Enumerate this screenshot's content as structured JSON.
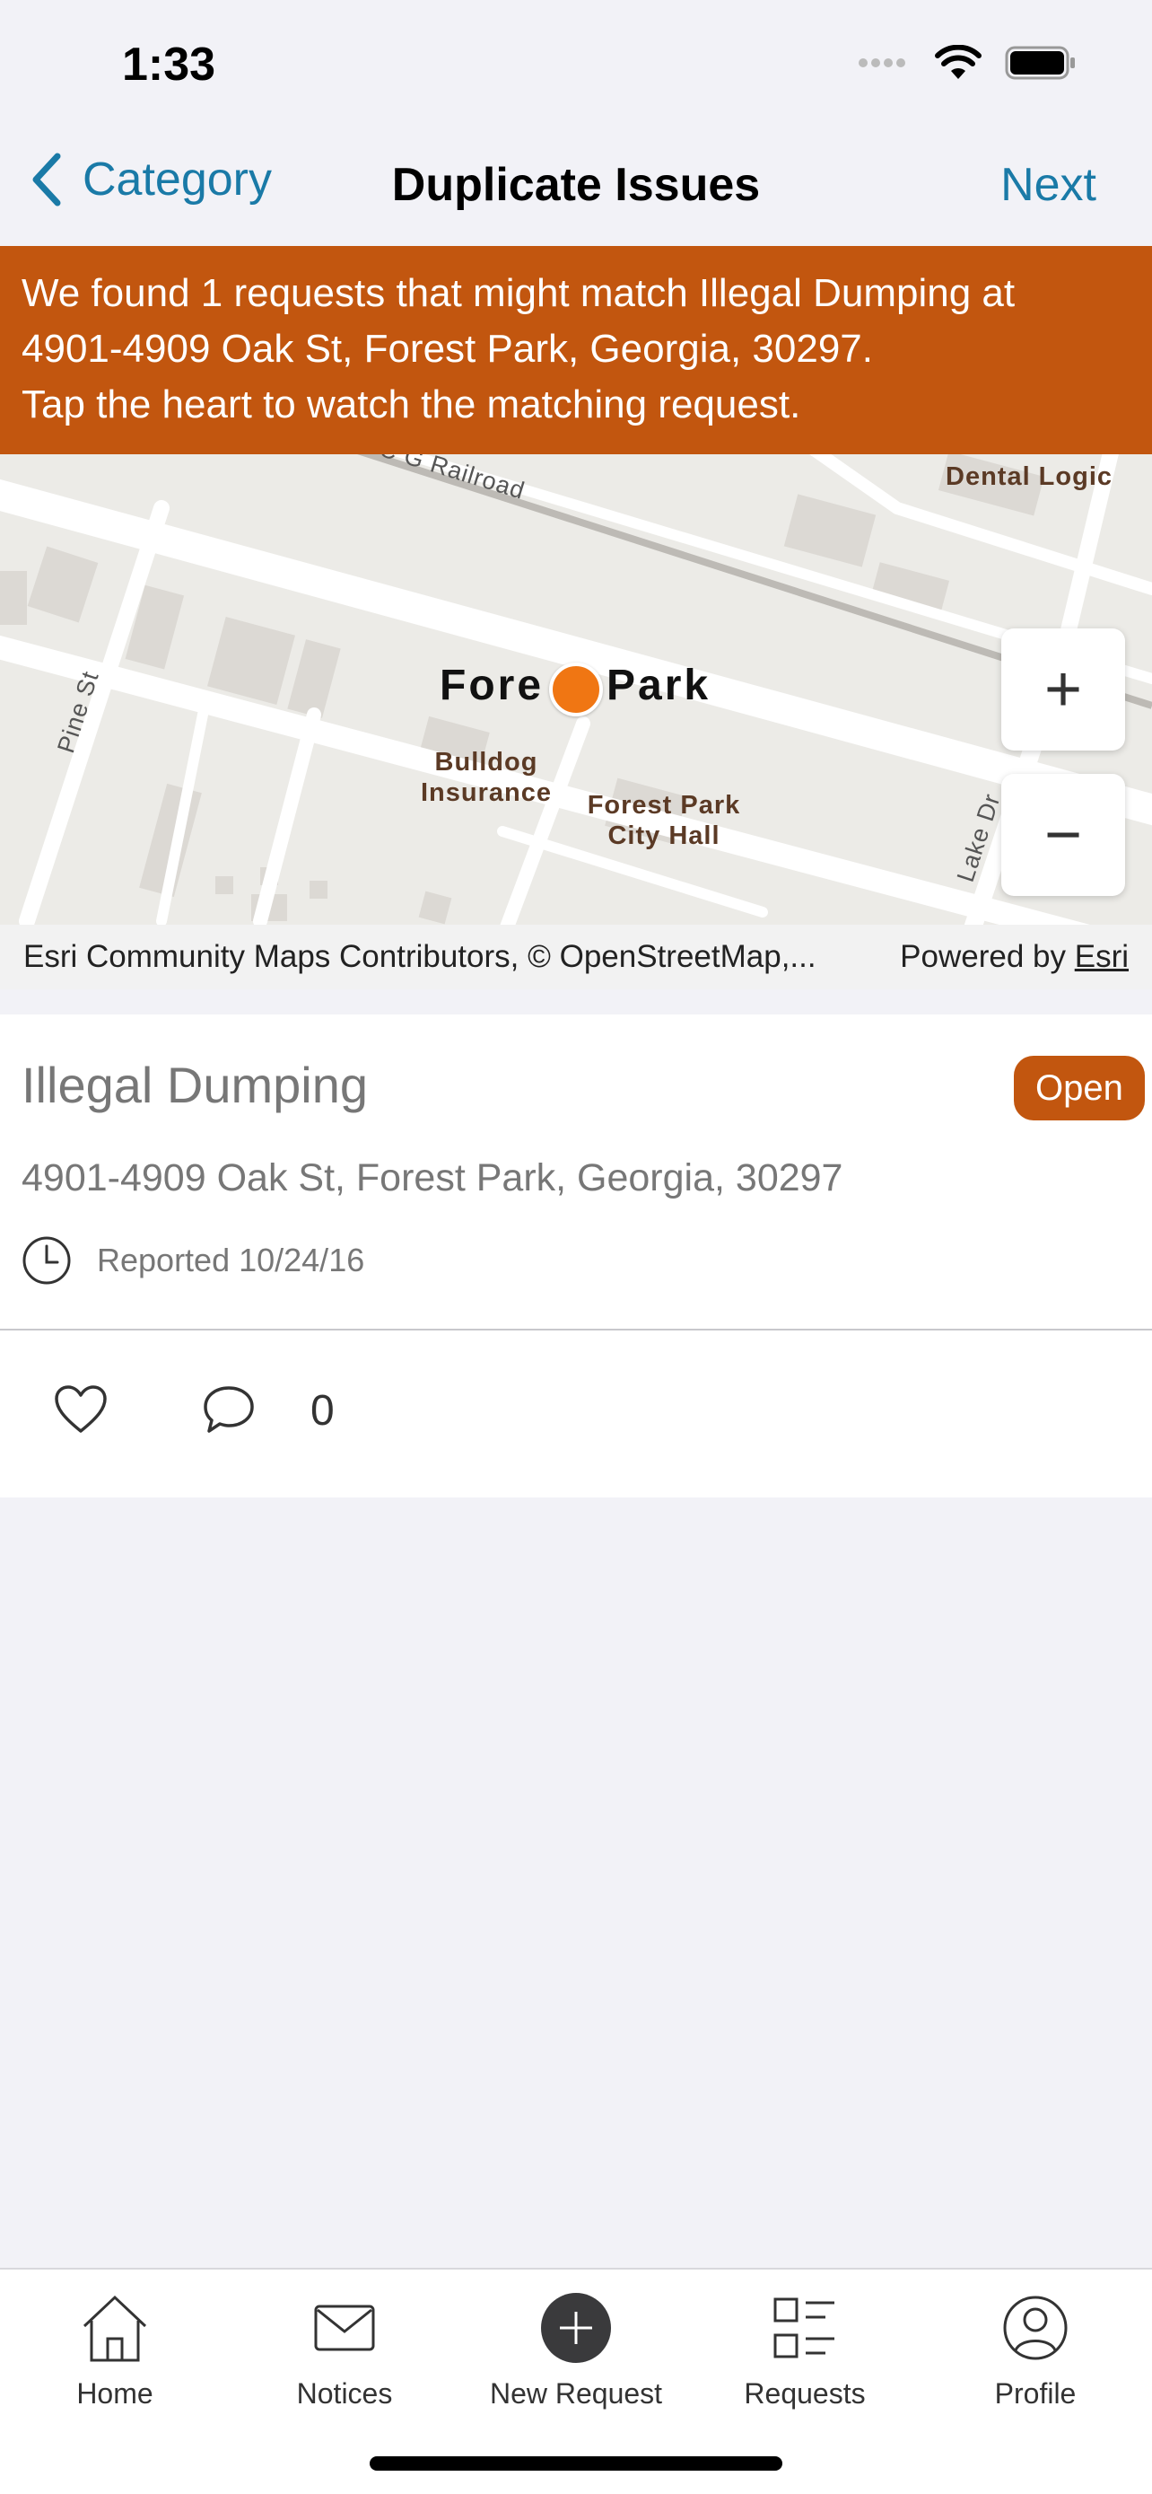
{
  "status_bar": {
    "time": "1:33"
  },
  "nav": {
    "back_label": "Category",
    "title": "Duplicate Issues",
    "next_label": "Next"
  },
  "banner": {
    "line1": "We found 1 requests that might match Illegal Dumping at",
    "line2": "4901-4909 Oak St, Forest Park, Georgia, 30297.",
    "line3": "Tap the heart to watch the matching request."
  },
  "map": {
    "labels": {
      "railroad": "C G Railroad",
      "dental": "Dental Logic",
      "pine": "Pine St",
      "bulldog": "Bulldog Insurance",
      "cityhall": "Forest Park City Hall",
      "lake": "Lake Dr",
      "town_left": "Fore",
      "town_right": "Park"
    },
    "zoom_in": "+",
    "zoom_out": "−",
    "attribution": "Esri Community Maps Contributors, © OpenStreetMap,...",
    "powered_by": "Powered by",
    "powered_by_link": "Esri"
  },
  "issue": {
    "title": "Illegal Dumping",
    "status": "Open",
    "address": "4901-4909 Oak St, Forest Park, Georgia, 30297",
    "reported": "Reported 10/24/16",
    "comment_count": "0"
  },
  "tabs": [
    {
      "label": "Home",
      "icon": "home-icon"
    },
    {
      "label": "Notices",
      "icon": "mail-icon"
    },
    {
      "label": "New Request",
      "icon": "plus-circle-icon"
    },
    {
      "label": "Requests",
      "icon": "list-icon"
    },
    {
      "label": "Profile",
      "icon": "person-icon"
    }
  ],
  "colors": {
    "accent": "#1a7aa7",
    "banner": "#c2560f",
    "pin": "#f07613"
  }
}
